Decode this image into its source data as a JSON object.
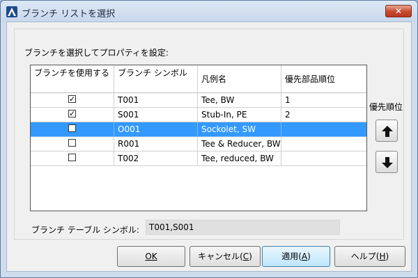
{
  "window": {
    "title": "ブランチ リストを選択",
    "close_glyph": "✕"
  },
  "instruction": "ブランチを選択してプロパティを設定:",
  "grid": {
    "headers": [
      "ブランチを使用する",
      "ブランチ シンボル",
      "凡例名",
      "優先部品順位"
    ],
    "rows": [
      {
        "checked": true,
        "symbol": "T001",
        "legend": "Tee, BW",
        "priority": "1",
        "selected": false
      },
      {
        "checked": true,
        "symbol": "S001",
        "legend": "Stub-In, PE",
        "priority": "2",
        "selected": false
      },
      {
        "checked": false,
        "symbol": "O001",
        "legend": "Sockolet, SW",
        "priority": "",
        "selected": true
      },
      {
        "checked": false,
        "symbol": "R001",
        "legend": "Tee & Reducer, BW",
        "priority": "",
        "selected": false
      },
      {
        "checked": false,
        "symbol": "T002",
        "legend": "Tee, reduced, BW",
        "priority": "",
        "selected": false
      }
    ]
  },
  "priority_panel": {
    "label": "優先順位",
    "up_icon": "arrow-up-icon",
    "down_icon": "arrow-down-icon"
  },
  "branch_table": {
    "label": "ブランチ テーブル シンボル:",
    "value": "T001,S001"
  },
  "buttons": {
    "ok": {
      "text": "OK",
      "mnemonic": ""
    },
    "cancel": {
      "text": "キャンセル(",
      "mnemonic": "C",
      "suffix": ")"
    },
    "apply": {
      "text": "適用(",
      "mnemonic": "A",
      "suffix": ")"
    },
    "help": {
      "text": "ヘルプ(",
      "mnemonic": "H",
      "suffix": ")"
    }
  },
  "colors": {
    "selection": "#3399ff",
    "close_button": "#c6492d"
  }
}
